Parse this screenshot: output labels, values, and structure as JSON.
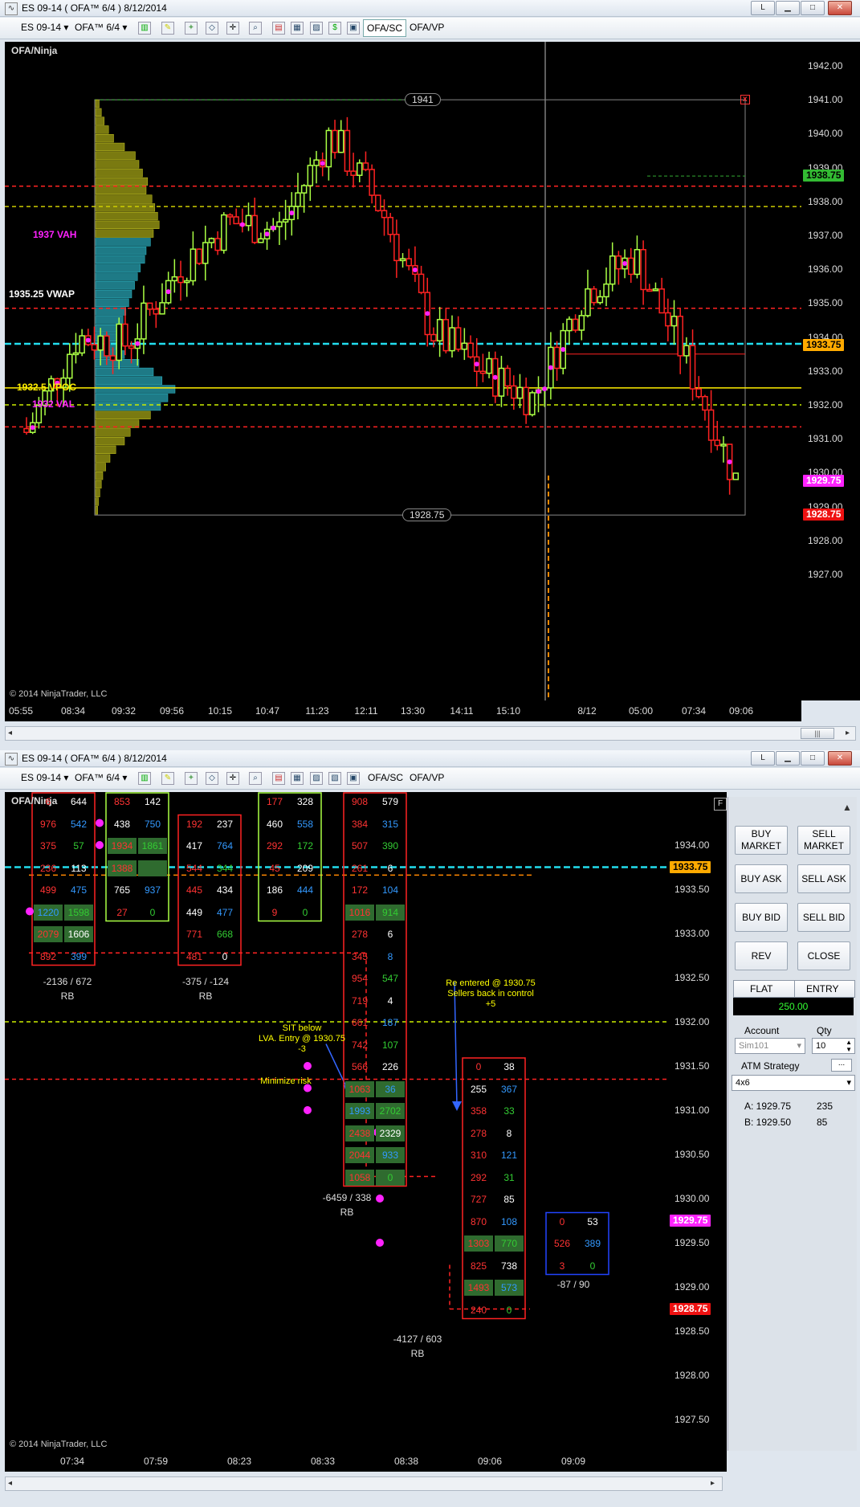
{
  "top": {
    "title": "ES 09-14 ( OFA™ 6/4 )  8/12/2014",
    "instrument": "ES 09-14",
    "period": "OFA™ 6/4",
    "tab_sc": "OFA/SC",
    "tab_vp": "OFA/VP",
    "panel_label": "OFA/Ninja",
    "copyright": "© 2014 NinjaTrader, LLC",
    "y_ticks": [
      "1942.00",
      "1941.00",
      "1940.00",
      "1939.00",
      "1938.00",
      "1937.00",
      "1936.00",
      "1935.00",
      "1934.00",
      "1933.00",
      "1932.00",
      "1931.00",
      "1930.00",
      "1929.00",
      "1928.00",
      "1927.00"
    ],
    "x_ticks": [
      "05:55",
      "08:34",
      "09:32",
      "09:56",
      "10:15",
      "10:47",
      "11:23",
      "12:11",
      "13:30",
      "14:11",
      "15:10",
      "8/12",
      "05:00",
      "07:34",
      "09:06"
    ],
    "badges": {
      "b1938": "1938.75",
      "b1933": "1933.75",
      "b1929": "1929.75",
      "b1928": "1928.75"
    },
    "range_high": "1941",
    "range_low": "1928.75",
    "vah": "1937 VAH",
    "vwap": "1935.25 VWAP",
    "vpoc": "1932.5 VPOC",
    "val": "1932 VAL",
    "x_mark": "x"
  },
  "bottom": {
    "title": "ES 09-14 ( OFA™ 6/4 )  8/12/2014",
    "instrument": "ES 09-14",
    "period": "OFA™ 6/4",
    "tab_sc": "OFA/SC",
    "tab_vp": "OFA/VP",
    "panel_label": "OFA/Ninja",
    "copyright": "© 2014 NinjaTrader, LLC",
    "y_ticks": [
      "1934.00",
      "1933.50",
      "1933.00",
      "1932.50",
      "1932.00",
      "1931.50",
      "1931.00",
      "1930.50",
      "1930.00",
      "1929.50",
      "1929.00",
      "1928.50",
      "1928.00",
      "1927.50"
    ],
    "x_ticks": [
      "07:34",
      "07:59",
      "08:23",
      "08:33",
      "08:38",
      "09:06",
      "09:09"
    ],
    "badges": {
      "b1933": "1933.75",
      "b1929": "1929.75",
      "b1928": "1928.75"
    },
    "notes": {
      "sit": "SIT below\nLVA.  Entry @ 1930.75\n-3",
      "minimize": "Minimize risk",
      "reenter": "Re entered @ 1930.75\nSellers back in control\n+5"
    },
    "summaries": [
      {
        "text": "-2136 / 672",
        "tag": "RB"
      },
      {
        "text": "-375 / -124",
        "tag": "RB"
      },
      {
        "text": "-6459 / 338",
        "tag": "RB"
      },
      {
        "text": "-4127 / 603",
        "tag": "RB"
      },
      {
        "text": "-87 / 90",
        "tag": ""
      }
    ],
    "columns": [
      {
        "rows": [
          [
            "6",
            "644"
          ],
          [
            "976",
            "542"
          ],
          [
            "375",
            "57"
          ],
          [
            "236",
            "113"
          ],
          [
            "499",
            "475"
          ],
          [
            "1220",
            "1598"
          ],
          [
            "2079",
            "1606"
          ],
          [
            "892",
            "399"
          ]
        ]
      },
      {
        "rows": [
          [
            "853",
            "142"
          ],
          [
            "438",
            "750"
          ],
          [
            "1934",
            "1861"
          ],
          [
            "1388",
            ""
          ],
          [
            "765",
            "937"
          ],
          [
            "27",
            "0"
          ]
        ]
      },
      {
        "rows": [
          [
            "192",
            "237"
          ],
          [
            "417",
            "764"
          ],
          [
            "544",
            "344"
          ],
          [
            "445",
            "434"
          ],
          [
            "449",
            "477"
          ],
          [
            "771",
            "668"
          ],
          [
            "481",
            "0"
          ]
        ]
      },
      {
        "rows": [
          [
            "177",
            "328"
          ],
          [
            "460",
            "558"
          ],
          [
            "292",
            "172"
          ],
          [
            "45",
            "209"
          ],
          [
            "186",
            "444"
          ],
          [
            "9",
            "0"
          ]
        ]
      },
      {
        "rows": [
          [
            "908",
            "579"
          ],
          [
            "384",
            "315"
          ],
          [
            "507",
            "390"
          ],
          [
            "261",
            "6"
          ],
          [
            "172",
            "104"
          ],
          [
            "1016",
            "914"
          ],
          [
            "278",
            "6"
          ],
          [
            "345",
            "8"
          ],
          [
            "954",
            "547"
          ],
          [
            "719",
            "4"
          ],
          [
            "661",
            "187"
          ],
          [
            "742",
            "107"
          ],
          [
            "566",
            "226"
          ],
          [
            "1063",
            "36"
          ],
          [
            "1993",
            "2702"
          ],
          [
            "2438",
            "2329"
          ],
          [
            "2044",
            "933"
          ],
          [
            "1058",
            "0"
          ]
        ]
      },
      {
        "rows": [
          [
            "0",
            "38"
          ],
          [
            "255",
            "367"
          ],
          [
            "358",
            "33"
          ],
          [
            "278",
            "8"
          ],
          [
            "310",
            "121"
          ],
          [
            "292",
            "31"
          ],
          [
            "727",
            "85"
          ],
          [
            "870",
            "108"
          ],
          [
            "1303",
            "770"
          ],
          [
            "825",
            "738"
          ],
          [
            "1493",
            "573"
          ],
          [
            "240",
            "0"
          ]
        ]
      },
      {
        "rows": [
          [
            "0",
            "53"
          ],
          [
            "526",
            "389"
          ],
          [
            "3",
            "0"
          ]
        ]
      }
    ]
  },
  "side": {
    "buy_market": "BUY MARKET",
    "sell_market": "SELL MARKET",
    "buy_ask": "BUY ASK",
    "sell_ask": "SELL ASK",
    "buy_bid": "BUY BID",
    "sell_bid": "SELL BID",
    "rev": "REV",
    "close": "CLOSE",
    "flat": "FLAT",
    "entry": "ENTRY",
    "pnl": "250.00",
    "account_label": "Account",
    "qty_label": "Qty",
    "account": "Sim101",
    "qty": "10",
    "atm_label": "ATM Strategy",
    "atm_more": "...",
    "atm": "4x6",
    "ask_label": "A: 1929.75",
    "ask_size": "235",
    "bid_label": "B: 1929.50",
    "bid_size": "85"
  },
  "colors": {
    "up": "#aaff44",
    "down": "#ff2222",
    "cyan": "#22ddee",
    "magenta": "#ff22ff",
    "yellow": "#ffee00"
  },
  "chart_data": {
    "type": "candlestick",
    "x": [
      "05:55",
      "08:34",
      "09:32",
      "09:56",
      "10:15",
      "10:47",
      "11:23",
      "12:11",
      "13:30",
      "14:11",
      "15:10",
      "8/12",
      "05:00",
      "07:34",
      "09:06"
    ],
    "ylim": [
      1926.75,
      1942.25
    ],
    "close": [
      1931.2,
      1934.0,
      1933.8,
      1936.0,
      1937.4,
      1937.2,
      1940.0,
      1937.8,
      1934.2,
      1933.0,
      1932.2,
      1935.3,
      1936.4,
      1933.4,
      1929.8
    ],
    "levels": {
      "vah": 1937,
      "vwap": 1935.25,
      "vpoc": 1932.5,
      "val": 1932,
      "high": 1941,
      "low": 1928.75
    }
  }
}
